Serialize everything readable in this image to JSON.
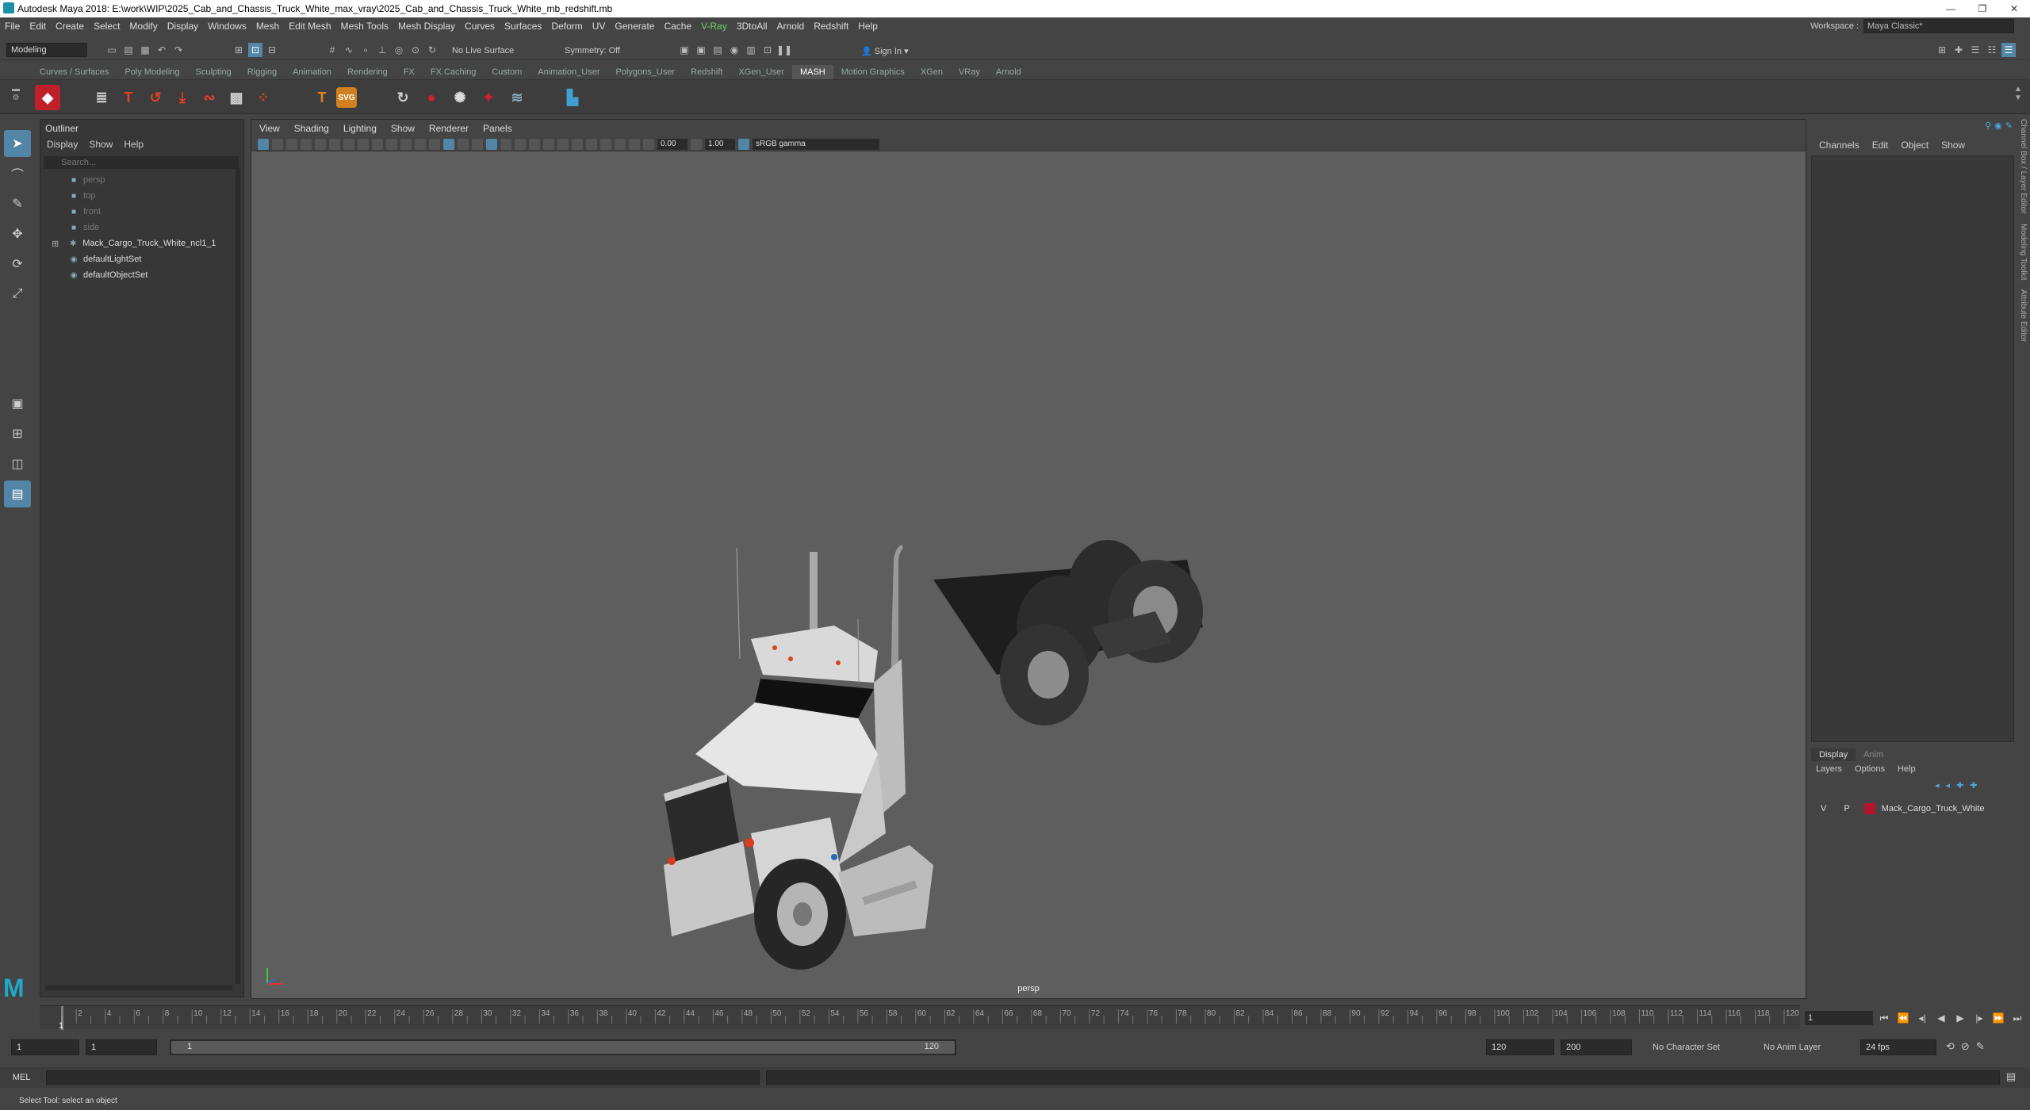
{
  "window": {
    "title": "Autodesk Maya 2018: E:\\work\\WIP\\2025_Cab_and_Chassis_Truck_White_max_vray\\2025_Cab_and_Chassis_Truck_White_mb_redshift.mb"
  },
  "menu": [
    "File",
    "Edit",
    "Create",
    "Select",
    "Modify",
    "Display",
    "Windows",
    "Mesh",
    "Edit Mesh",
    "Mesh Tools",
    "Mesh Display",
    "Curves",
    "Surfaces",
    "Deform",
    "UV",
    "Generate",
    "Cache",
    "V-Ray",
    "3DtoAll",
    "Arnold",
    "Redshift",
    "Help"
  ],
  "menu_vray_label": "V-Ray",
  "workspace": {
    "label": "Workspace :",
    "value": "Maya Classic*"
  },
  "status": {
    "mode": "Modeling",
    "live_surface": "No Live Surface",
    "symmetry": "Symmetry: Off",
    "sign_in": "Sign In"
  },
  "shelf_tabs": [
    "Curves / Surfaces",
    "Poly Modeling",
    "Sculpting",
    "Rigging",
    "Animation",
    "Rendering",
    "FX",
    "FX Caching",
    "Custom",
    "Animation_User",
    "Polygons_User",
    "Redshift",
    "XGen_User",
    "MASH",
    "Motion Graphics",
    "XGen",
    "VRay",
    "Arnold"
  ],
  "shelf_active": "MASH",
  "outliner": {
    "title": "Outliner",
    "menu": [
      "Display",
      "Show",
      "Help"
    ],
    "search_placeholder": "Search...",
    "items": [
      {
        "label": "persp",
        "dim": true,
        "icon": "camera-icon"
      },
      {
        "label": "top",
        "dim": true,
        "icon": "camera-icon"
      },
      {
        "label": "front",
        "dim": true,
        "icon": "camera-icon"
      },
      {
        "label": "side",
        "dim": true,
        "icon": "camera-icon"
      },
      {
        "label": "Mack_Cargo_Truck_White_ncl1_1",
        "dim": false,
        "icon": "group-icon"
      },
      {
        "label": "defaultLightSet",
        "dim": false,
        "icon": "set-icon"
      },
      {
        "label": "defaultObjectSet",
        "dim": false,
        "icon": "set-icon"
      }
    ]
  },
  "viewport": {
    "menu": [
      "View",
      "Shading",
      "Lighting",
      "Show",
      "Renderer",
      "Panels"
    ],
    "exposure": "0.00",
    "gamma": "1.00",
    "color_space": "sRGB gamma",
    "camera_label": "persp"
  },
  "channelbox": {
    "menu": [
      "Channels",
      "Edit",
      "Object",
      "Show"
    ]
  },
  "layers": {
    "tabs": [
      "Display",
      "Anim"
    ],
    "menu": [
      "Layers",
      "Options",
      "Help"
    ],
    "row": {
      "v": "V",
      "p": "P",
      "name": "Mack_Cargo_Truck_White",
      "color": "#b4142e"
    }
  },
  "side_tabs": [
    "Channel Box / Layer Editor",
    "Modeling Toolkit",
    "Attribute Editor"
  ],
  "timeline": {
    "ticks": [
      2,
      4,
      6,
      8,
      10,
      12,
      14,
      16,
      18,
      20,
      22,
      24,
      26,
      28,
      30,
      32,
      34,
      36,
      38,
      40,
      42,
      44,
      46,
      48,
      50,
      52,
      54,
      56,
      58,
      60,
      62,
      64,
      66,
      68,
      70,
      72,
      74,
      76,
      78,
      80,
      82,
      84,
      86,
      88,
      90,
      92,
      94,
      96,
      98,
      100,
      102,
      104,
      106,
      108,
      110,
      112,
      114,
      116,
      118,
      120
    ],
    "current_frame_label": "1",
    "current": "1"
  },
  "range": {
    "start": "1",
    "anim_start": "1",
    "slider_start": "1",
    "slider_end": "120",
    "end": "120",
    "anim_end": "200",
    "character_set": "No Character Set",
    "anim_layer": "No Anim Layer",
    "fps": "24 fps"
  },
  "cmdline": {
    "label": "MEL"
  },
  "helpline": {
    "text": "Select Tool: select an object"
  }
}
